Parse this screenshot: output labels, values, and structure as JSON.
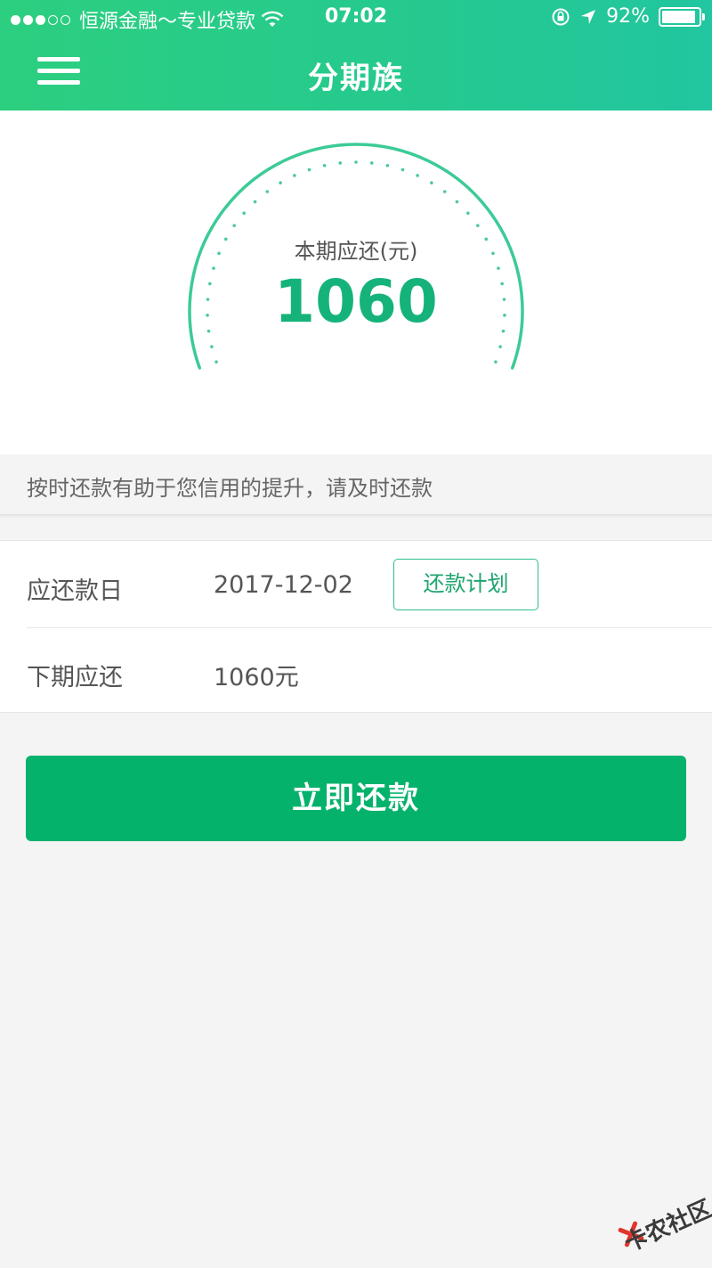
{
  "status_bar": {
    "carrier": "恒源金融～专业贷款",
    "time": "07:02",
    "battery_percent": "92%",
    "battery_level": 0.92,
    "icons": [
      "signal-dots-icon",
      "wifi-icon",
      "rotation-lock-icon",
      "location-arrow-icon",
      "battery-icon"
    ]
  },
  "nav": {
    "title": "分期族",
    "menu_icon": "hamburger-menu-icon"
  },
  "gauge": {
    "label": "本期应还(元)",
    "value": "1060"
  },
  "tip": "按时还款有助于您信用的提升，请及时还款",
  "details": {
    "due_date_label": "应还款日",
    "due_date_value": "2017-12-02",
    "plan_button": "还款计划",
    "next_label": "下期应还",
    "next_value": "1060元"
  },
  "pay_button": "立即还款",
  "watermark": "卡农社区",
  "colors": {
    "accent": "#05b26c",
    "header_gradient_start": "#2ccf7f",
    "header_gradient_end": "#22c6a0",
    "gauge_number": "#15b37a"
  }
}
